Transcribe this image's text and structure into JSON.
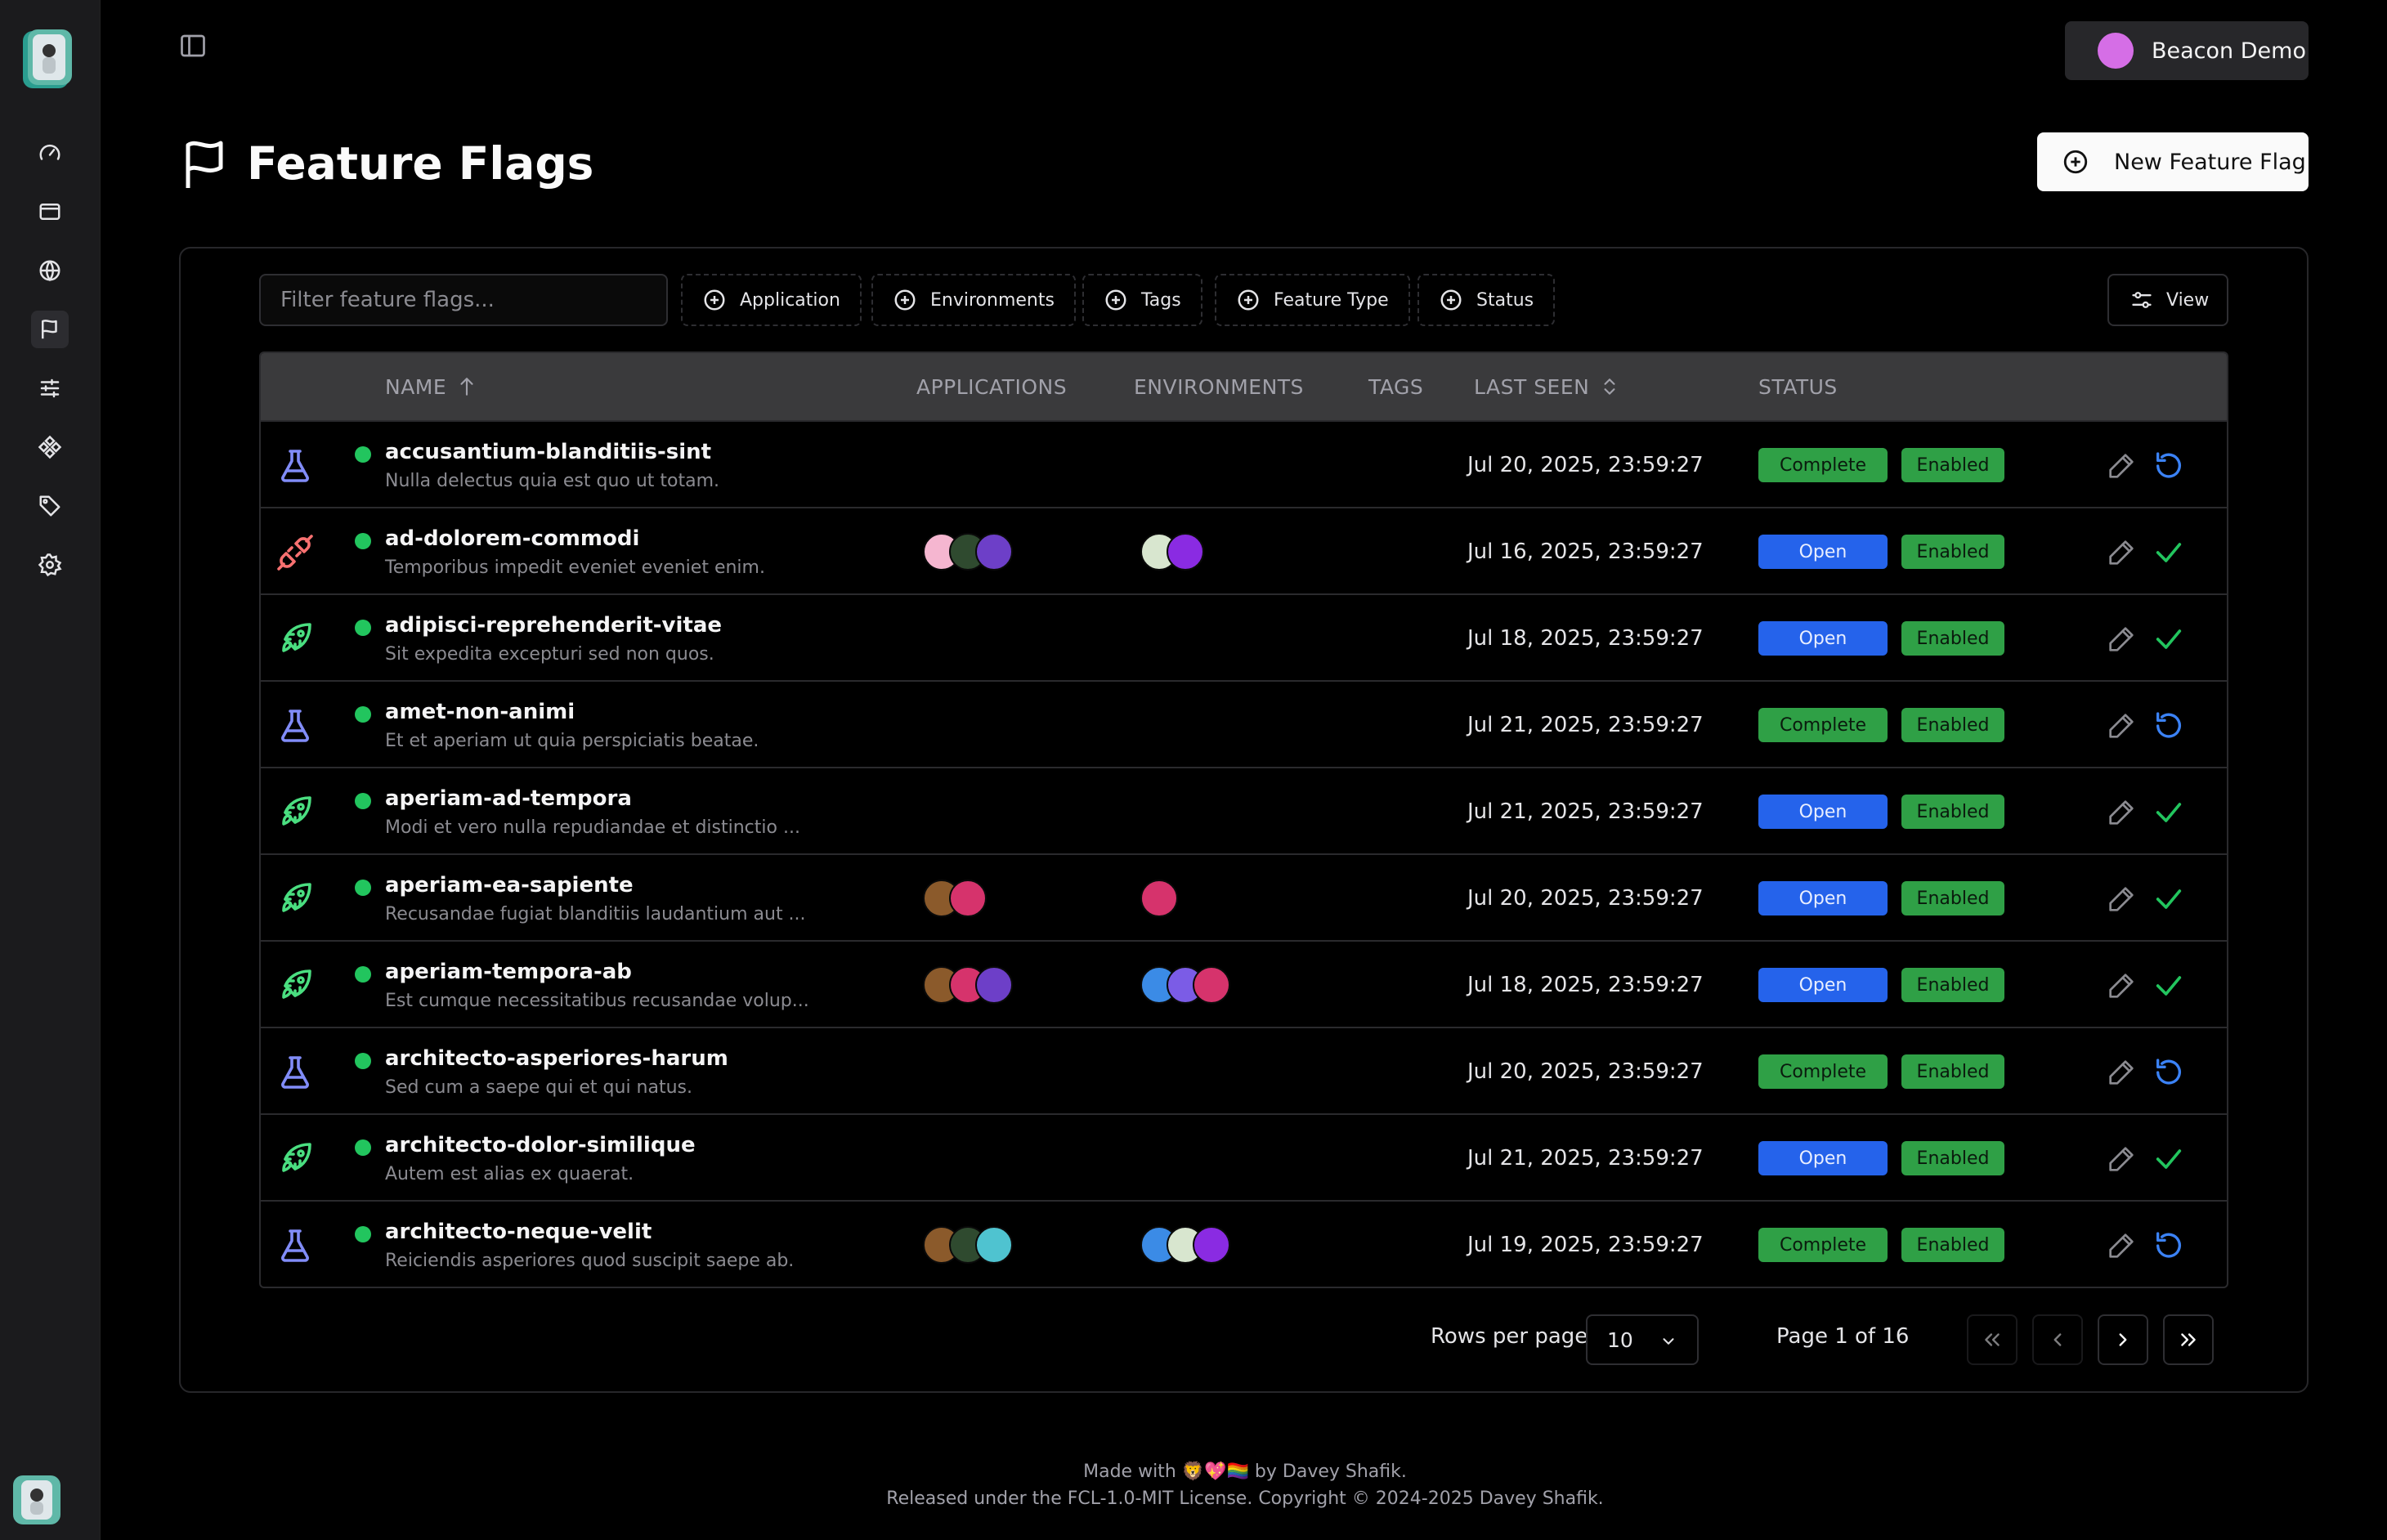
{
  "account": {
    "label": "Beacon Demo",
    "avatar_color": "#d56ee6"
  },
  "page": {
    "title": "Feature Flags",
    "new_button": "New Feature Flag"
  },
  "filters": {
    "search_placeholder": "Filter feature flags...",
    "chips": [
      "Application",
      "Environments",
      "Tags",
      "Feature Type",
      "Status"
    ],
    "view_label": "View"
  },
  "table": {
    "headers": {
      "name": "NAME",
      "applications": "APPLICATIONS",
      "environments": "ENVIRONMENTS",
      "tags": "TAGS",
      "last_seen": "LAST SEEN",
      "status": "STATUS"
    },
    "rows": [
      {
        "type": "experiment",
        "name": "accusantium-blanditiis-sint",
        "description": "Nulla delectus quia est quo ut totam.",
        "applications": [],
        "environments": [],
        "last_seen": "Jul 20, 2025, 23:59:27",
        "status": "Complete",
        "state": "Enabled",
        "action": "reset"
      },
      {
        "type": "kill-switch",
        "name": "ad-dolorem-commodi",
        "description": "Temporibus impedit eveniet eveniet enim.",
        "applications": [
          "#f5b6d0",
          "#2f4a2f",
          "#6d3fc8"
        ],
        "environments": [
          "#d8e6cf",
          "#8a2be2"
        ],
        "last_seen": "Jul 16, 2025, 23:59:27",
        "status": "Open",
        "state": "Enabled",
        "action": "check"
      },
      {
        "type": "release",
        "name": "adipisci-reprehenderit-vitae",
        "description": "Sit expedita excepturi sed non quos.",
        "applications": [],
        "environments": [],
        "last_seen": "Jul 18, 2025, 23:59:27",
        "status": "Open",
        "state": "Enabled",
        "action": "check"
      },
      {
        "type": "experiment",
        "name": "amet-non-animi",
        "description": "Et et aperiam ut quia perspiciatis beatae.",
        "applications": [],
        "environments": [],
        "last_seen": "Jul 21, 2025, 23:59:27",
        "status": "Complete",
        "state": "Enabled",
        "action": "reset"
      },
      {
        "type": "release",
        "name": "aperiam-ad-tempora",
        "description": "Modi et vero nulla repudiandae et distinctio ...",
        "applications": [],
        "environments": [],
        "last_seen": "Jul 21, 2025, 23:59:27",
        "status": "Open",
        "state": "Enabled",
        "action": "check"
      },
      {
        "type": "release",
        "name": "aperiam-ea-sapiente",
        "description": "Recusandae fugiat blanditiis laudantium aut ...",
        "applications": [
          "#8b5a2b",
          "#d6336c"
        ],
        "environments": [
          "#d6336c"
        ],
        "last_seen": "Jul 20, 2025, 23:59:27",
        "status": "Open",
        "state": "Enabled",
        "action": "check"
      },
      {
        "type": "release",
        "name": "aperiam-tempora-ab",
        "description": "Est cumque necessitatibus recusandae volup...",
        "applications": [
          "#8b5a2b",
          "#d6336c",
          "#6d3fc8"
        ],
        "environments": [
          "#3b8be6",
          "#7b5ce6",
          "#d6336c"
        ],
        "last_seen": "Jul 18, 2025, 23:59:27",
        "status": "Open",
        "state": "Enabled",
        "action": "check"
      },
      {
        "type": "experiment",
        "name": "architecto-asperiores-harum",
        "description": "Sed cum a saepe qui et qui natus.",
        "applications": [],
        "environments": [],
        "last_seen": "Jul 20, 2025, 23:59:27",
        "status": "Complete",
        "state": "Enabled",
        "action": "reset"
      },
      {
        "type": "release",
        "name": "architecto-dolor-similique",
        "description": "Autem est alias ex quaerat.",
        "applications": [],
        "environments": [],
        "last_seen": "Jul 21, 2025, 23:59:27",
        "status": "Open",
        "state": "Enabled",
        "action": "check"
      },
      {
        "type": "experiment",
        "name": "architecto-neque-velit",
        "description": "Reiciendis asperiores quod suscipit saepe ab.",
        "applications": [
          "#8b5a2b",
          "#2f4a2f",
          "#4fc3d0"
        ],
        "environments": [
          "#3b8be6",
          "#d8e6cf",
          "#8a2be2"
        ],
        "last_seen": "Jul 19, 2025, 23:59:27",
        "status": "Complete",
        "state": "Enabled",
        "action": "reset"
      }
    ]
  },
  "pagination": {
    "rows_label": "Rows per page",
    "rows_value": "10",
    "page_label": "Page 1 of 16"
  },
  "footer": {
    "line1": "Made with 🦁💖🏳️‍🌈 by Davey Shafik.",
    "line2": "Released under the FCL-1.0-MIT License. Copyright © 2024-2025 Davey Shafik."
  },
  "colors": {
    "complete": "#2fa046",
    "open": "#2563eb",
    "enabled": "#2fa046",
    "experiment_icon": "#818cf8",
    "release_icon": "#4ade80",
    "kill_switch_icon": "#f87171"
  }
}
